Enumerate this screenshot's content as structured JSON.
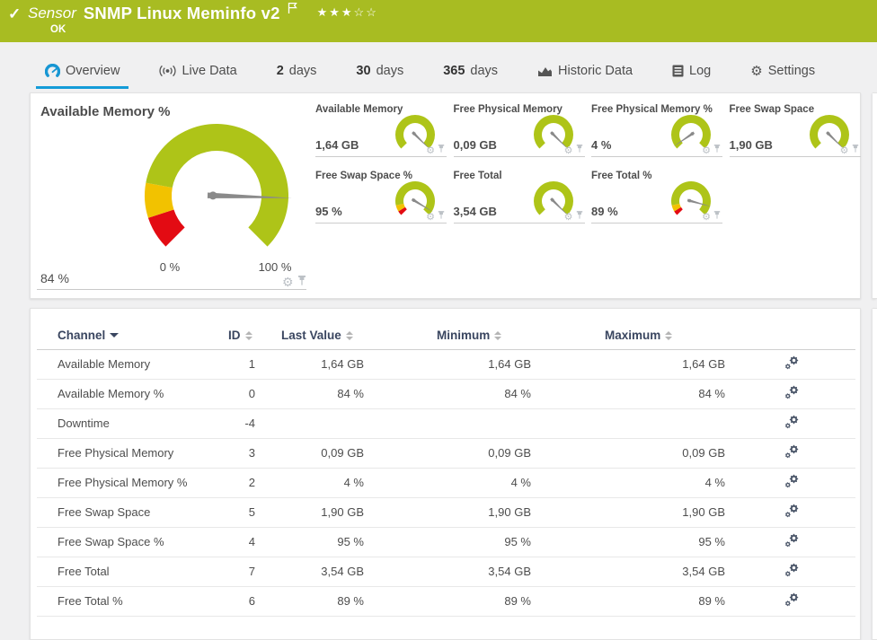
{
  "colors": {
    "header_green": "#a8bc22",
    "tab_accent_blue": "#149cd8",
    "gauge_green": "#aec418",
    "gauge_yellow": "#f2c200",
    "gauge_red": "#e30b13",
    "needle_gray": "#8a8a8a",
    "table_icon": "#4a5568",
    "tile_icon": "#bcc1c6"
  },
  "header": {
    "check_icon": "✓",
    "kind": "Sensor",
    "title": "SNMP Linux Meminfo v2",
    "status": "OK",
    "stars": "★★★☆☆",
    "rating_filled": 3,
    "rating_total": 5
  },
  "tabs": [
    {
      "label": "Overview",
      "active": true
    },
    {
      "label": "Live Data",
      "active": false
    },
    {
      "num": "2",
      "label": "days",
      "active": false
    },
    {
      "num": "30",
      "label": "days",
      "active": false
    },
    {
      "num": "365",
      "label": "days",
      "active": false
    },
    {
      "label": "Historic Data",
      "active": false
    },
    {
      "label": "Log",
      "active": false
    },
    {
      "label": "Settings",
      "active": false
    }
  ],
  "chart_data": {
    "type": "gauge-set",
    "note": "270-degree radial gauges, needle percent of full sweep",
    "main": {
      "title": "Available Memory %",
      "value_label": "84 %",
      "min_label": "0 %",
      "max_label": "100 %",
      "percent": 0.84,
      "segments": [
        {
          "from": 0,
          "to": 0.1,
          "color": "red"
        },
        {
          "from": 0.1,
          "to": 0.205,
          "color": "yellow"
        },
        {
          "from": 0.205,
          "to": 1,
          "color": "green"
        }
      ]
    },
    "small": [
      {
        "title": "Available Memory",
        "value_label": "1,64 GB",
        "percent": 1.0,
        "segments": [
          {
            "from": 0,
            "to": 1,
            "color": "green"
          }
        ]
      },
      {
        "title": "Free Physical Memory",
        "value_label": "0,09 GB",
        "percent": 1.0,
        "segments": [
          {
            "from": 0,
            "to": 1,
            "color": "green"
          }
        ]
      },
      {
        "title": "Free Physical Memory %",
        "value_label": "4 %",
        "percent": 0.04,
        "segments": [
          {
            "from": 0,
            "to": 1,
            "color": "green"
          }
        ]
      },
      {
        "title": "Free Swap Space",
        "value_label": "1,90 GB",
        "percent": 1.0,
        "segments": [
          {
            "from": 0,
            "to": 1,
            "color": "green"
          }
        ]
      },
      {
        "title": "Free Swap Space %",
        "value_label": "95 %",
        "percent": 0.95,
        "segments": [
          {
            "from": 0,
            "to": 0.05,
            "color": "red"
          },
          {
            "from": 0.05,
            "to": 0.12,
            "color": "yellow"
          },
          {
            "from": 0.12,
            "to": 1,
            "color": "green"
          }
        ]
      },
      {
        "title": "Free Total",
        "value_label": "3,54 GB",
        "percent": 1.0,
        "segments": [
          {
            "from": 0,
            "to": 1,
            "color": "green"
          }
        ]
      },
      {
        "title": "Free Total %",
        "value_label": "89 %",
        "percent": 0.89,
        "segments": [
          {
            "from": 0,
            "to": 0.05,
            "color": "red"
          },
          {
            "from": 0.05,
            "to": 0.12,
            "color": "yellow"
          },
          {
            "from": 0.12,
            "to": 1,
            "color": "green"
          }
        ]
      }
    ]
  },
  "table": {
    "columns": [
      {
        "label": "Channel",
        "sorted": "desc"
      },
      {
        "label": "ID",
        "sorted": "none"
      },
      {
        "label": "Last Value",
        "sorted": "none"
      },
      {
        "label": "Minimum",
        "sorted": "none"
      },
      {
        "label": "Maximum",
        "sorted": "none"
      }
    ],
    "rows": [
      {
        "channel": "Available Memory",
        "id": "1",
        "last": "1,64 GB",
        "min": "1,64 GB",
        "max": "1,64 GB"
      },
      {
        "channel": "Available Memory %",
        "id": "0",
        "last": "84 %",
        "min": "84 %",
        "max": "84 %"
      },
      {
        "channel": "Downtime",
        "id": "-4",
        "last": "",
        "min": "",
        "max": ""
      },
      {
        "channel": "Free Physical Memory",
        "id": "3",
        "last": "0,09 GB",
        "min": "0,09 GB",
        "max": "0,09 GB"
      },
      {
        "channel": "Free Physical Memory %",
        "id": "2",
        "last": "4 %",
        "min": "4 %",
        "max": "4 %"
      },
      {
        "channel": "Free Swap Space",
        "id": "5",
        "last": "1,90 GB",
        "min": "1,90 GB",
        "max": "1,90 GB"
      },
      {
        "channel": "Free Swap Space %",
        "id": "4",
        "last": "95 %",
        "min": "95 %",
        "max": "95 %"
      },
      {
        "channel": "Free Total",
        "id": "7",
        "last": "3,54 GB",
        "min": "3,54 GB",
        "max": "3,54 GB"
      },
      {
        "channel": "Free Total %",
        "id": "6",
        "last": "89 %",
        "min": "89 %",
        "max": "89 %"
      }
    ]
  }
}
